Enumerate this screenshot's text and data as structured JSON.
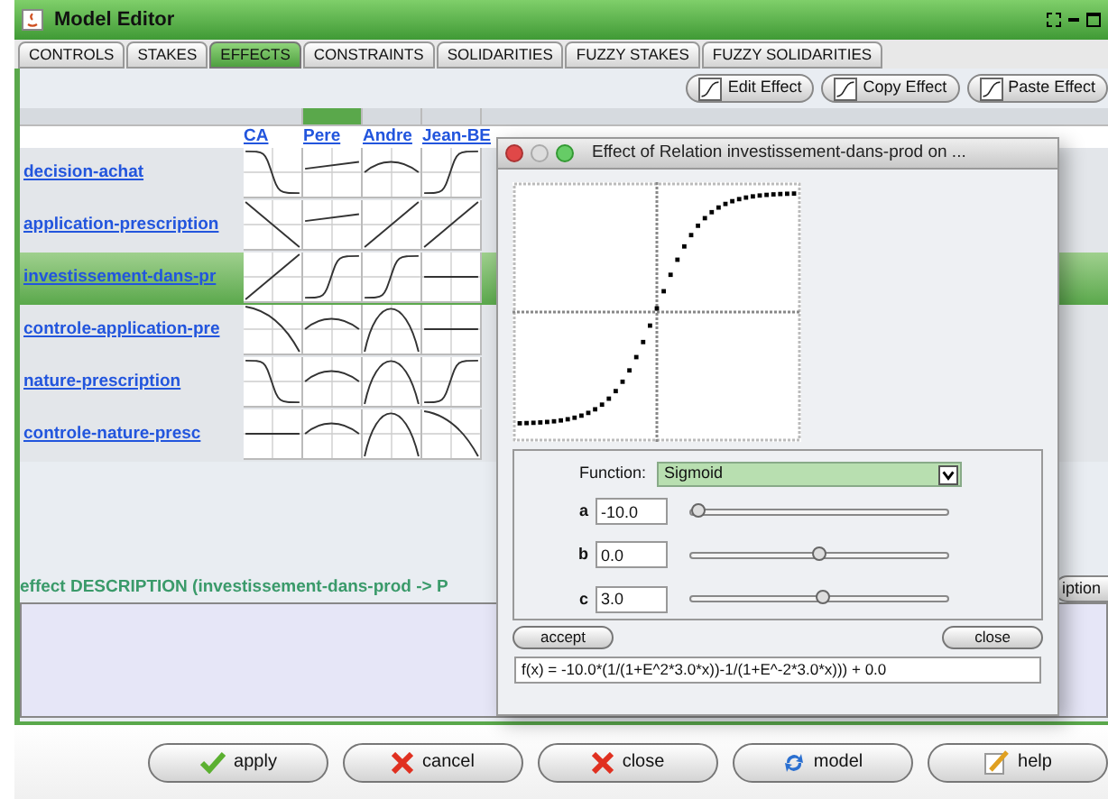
{
  "window": {
    "title": "Model Editor"
  },
  "tabs": [
    {
      "label": "CONTROLS",
      "selected": false
    },
    {
      "label": "STAKES",
      "selected": false
    },
    {
      "label": "EFFECTS",
      "selected": true
    },
    {
      "label": "CONSTRAINTS",
      "selected": false
    },
    {
      "label": "SOLIDARITIES",
      "selected": false
    },
    {
      "label": "FUZZY STAKES",
      "selected": false
    },
    {
      "label": "FUZZY SOLIDARITIES",
      "selected": false
    }
  ],
  "toolbar": [
    "Edit Effect",
    "Copy Effect",
    "Paste Effect"
  ],
  "matrix": {
    "columns": [
      {
        "label": "CA",
        "selected": false
      },
      {
        "label": "Pere",
        "selected": true
      },
      {
        "label": "Andre",
        "selected": false
      },
      {
        "label": "Jean-BE",
        "selected": false
      }
    ],
    "rows": [
      {
        "label": "decision-achat",
        "selected": false,
        "cells": [
          {
            "kind": "sigmoid-down"
          },
          {
            "kind": "slight-up"
          },
          {
            "kind": "hump"
          },
          {
            "kind": "sigmoid-up"
          }
        ]
      },
      {
        "label": "application-prescription",
        "selected": false,
        "cells": [
          {
            "kind": "linear-down"
          },
          {
            "kind": "slight-up"
          },
          {
            "kind": "linear-up"
          },
          {
            "kind": "linear-up"
          }
        ]
      },
      {
        "label": "investissement-dans-pr",
        "selected": true,
        "cells": [
          {
            "kind": "linear-up"
          },
          {
            "kind": "sigmoid-up"
          },
          {
            "kind": "sigmoid-up"
          },
          {
            "kind": "flat"
          }
        ]
      },
      {
        "label": "controle-application-pre",
        "selected": false,
        "cells": [
          {
            "kind": "decline"
          },
          {
            "kind": "hump"
          },
          {
            "kind": "bell"
          },
          {
            "kind": "flat"
          }
        ]
      },
      {
        "label": "nature-prescription",
        "selected": false,
        "cells": [
          {
            "kind": "sigmoid-down"
          },
          {
            "kind": "hump"
          },
          {
            "kind": "bell"
          },
          {
            "kind": "sigmoid-up"
          }
        ]
      },
      {
        "label": "controle-nature-presc",
        "selected": false,
        "cells": [
          {
            "kind": "flat"
          },
          {
            "kind": "hump"
          },
          {
            "kind": "bell"
          },
          {
            "kind": "decline"
          }
        ]
      }
    ]
  },
  "description": {
    "label": "effect DESCRIPTION (investissement-dans-prod -> P",
    "button": "iption"
  },
  "buttons": [
    {
      "label": "apply",
      "kind": "check"
    },
    {
      "label": "cancel",
      "kind": "cross"
    },
    {
      "label": "close",
      "kind": "cross"
    },
    {
      "label": "model",
      "kind": "refresh"
    },
    {
      "label": "help",
      "kind": "pencil"
    }
  ],
  "dialog": {
    "title": "Effect of Relation investissement-dans-prod on ...",
    "function_label": "Function:",
    "function": "Sigmoid",
    "params": [
      {
        "name": "a",
        "value": "-10.0",
        "level": 0.0
      },
      {
        "name": "b",
        "value": "0.0",
        "level": 0.49
      },
      {
        "name": "c",
        "value": "3.0",
        "level": 0.51
      }
    ],
    "accept": "accept",
    "close": "close",
    "formula": "f(x) = -10.0*(1/(1+E^2*3.0*x))-1/(1+E^-2*3.0*x))) + 0.0"
  }
}
